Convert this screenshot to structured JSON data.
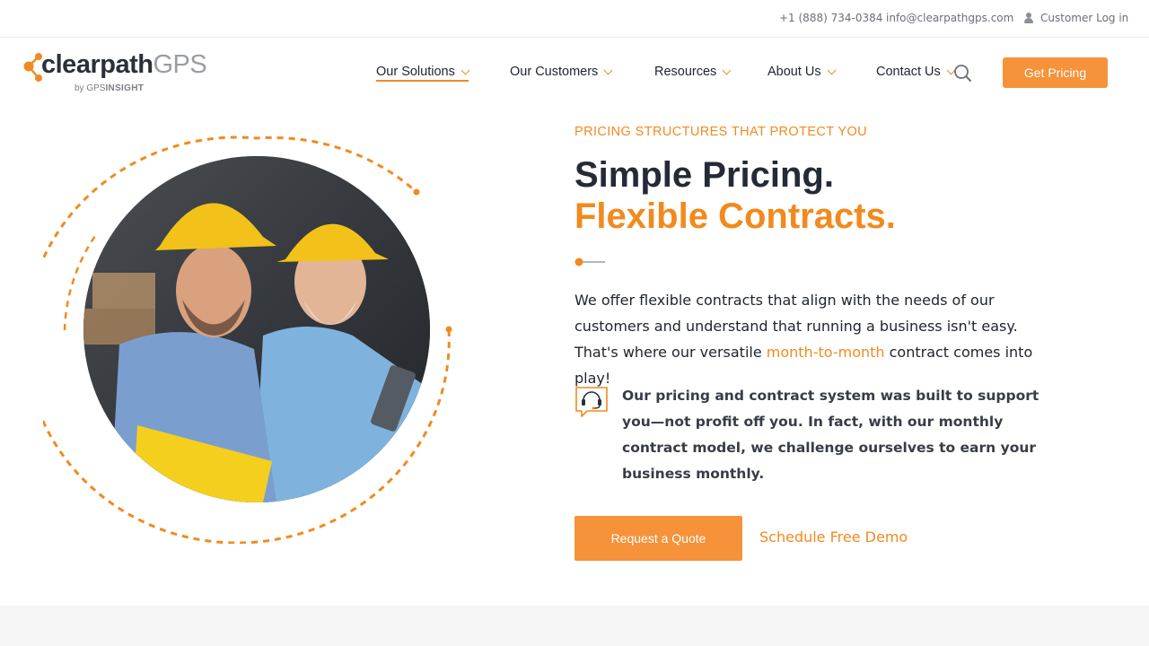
{
  "topbar": {
    "phone": "+1 (888) 734-0384",
    "email": "info@clearpathgps.com",
    "login": "Customer Log in",
    "login_icon": "user-icon"
  },
  "logo": {
    "main": "clearpath",
    "gps": "GPS",
    "by": "by ",
    "by_brand_1": "GPS",
    "by_brand_2": "INSIGHT"
  },
  "nav": {
    "items": [
      {
        "label": "Our Solutions",
        "active": true
      },
      {
        "label": "Our Customers"
      },
      {
        "label": "Resources"
      },
      {
        "label": "About Us"
      },
      {
        "label": "Contact Us"
      }
    ],
    "cta": "Get Pricing",
    "search_icon": "search-icon"
  },
  "hero": {
    "eyebrow": "PRICING STRUCTURES THAT PROTECT YOU",
    "headline_line1": "Simple Pricing.",
    "headline_line2": "Flexible Contracts.",
    "body_before": "We offer flexible contracts that align with the needs of our customers and understand that running a business isn't easy. That's where our versatile ",
    "body_link": "month-to-month",
    "body_after": " contract comes into play!",
    "callout_icon": "headset-support-icon",
    "callout": "Our pricing and contract system was built to support you—not profit off you. In fact, with our monthly contract model, we challenge ourselves to earn your business monthly.",
    "primary_cta": "Request a Quote",
    "secondary_cta": "Schedule Free Demo",
    "image_alt": "two-workers-hard-hats-photo"
  },
  "colors": {
    "accent": "#f18a1e",
    "button": "#f5923a",
    "heading": "#252a37"
  }
}
